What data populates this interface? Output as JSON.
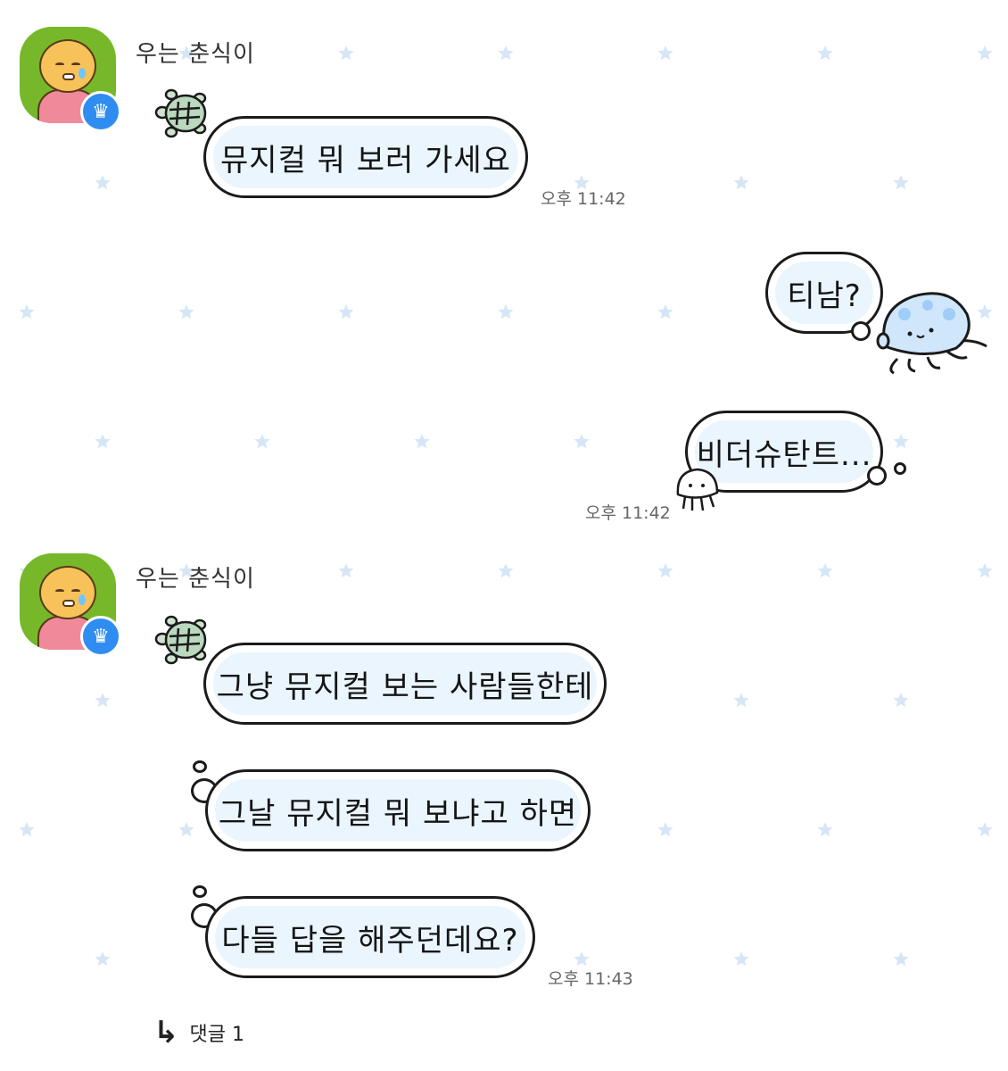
{
  "colors": {
    "bubble_fill": "#eaf5fe",
    "bubble_border": "#1b1b1b",
    "star": "#d6e6f7",
    "avatar_bg": "#76b82a",
    "badge": "#2f8cf0"
  },
  "groups": [
    {
      "sender": "우는 춘식이",
      "messages": [
        "뮤지컬 뭐 보러 가세요"
      ],
      "time": "오후 11:42"
    },
    {
      "outgoing": true,
      "messages": [
        "티남?",
        "비더슈탄트..."
      ],
      "time": "오후 11:42"
    },
    {
      "sender": "우는 춘식이",
      "messages": [
        "그냥 뮤지컬 보는 사람들한테",
        "그날 뮤지컬 뭐 보냐고 하면",
        "다들 답을 해주던데요?"
      ],
      "time": "오후 11:43"
    }
  ],
  "reply": {
    "icon": "reply-arrow-icon",
    "label": "댓글 1"
  }
}
